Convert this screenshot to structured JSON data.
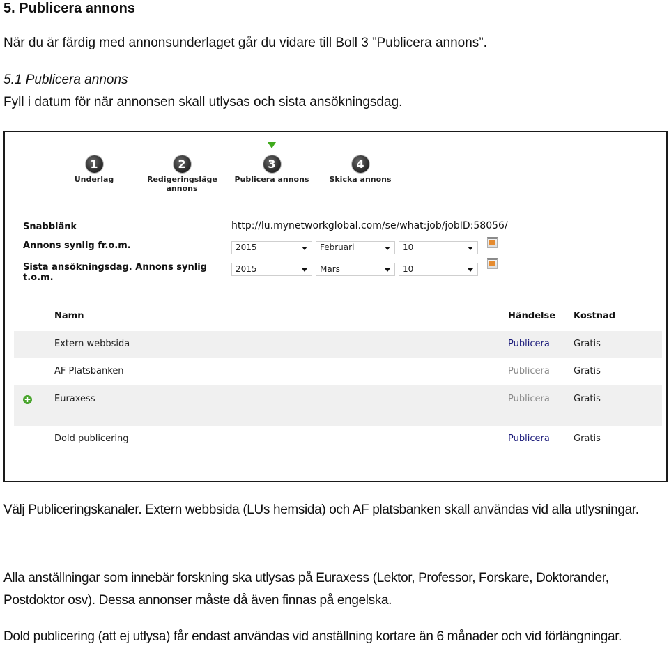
{
  "document": {
    "heading": "5.  Publicera annons",
    "intro": "När du är färdig med annonsunderlaget går du vidare till Boll 3 ”Publicera annons”.",
    "subheading": "5.1 Publicera annons",
    "subintro": "Fyll i datum för när annonsen skall utlysas och sista ansökningsdag.",
    "paragraphs": [
      "Välj Publiceringskanaler. Extern webbsida (LUs hemsida) och AF platsbanken skall användas vid alla utlysningar.",
      "Alla anställningar som innebär forskning ska utlysas på Euraxess (Lektor, Professor, Forskare, Doktorander, Postdoktor osv). Dessa annonser måste då även finnas på engelska.",
      "Dold publicering (att ej utlysa) får endast användas vid anställning kortare än 6 månader och vid förlängningar."
    ]
  },
  "screenshot": {
    "stepper": {
      "active_step": 3,
      "active_color": "#3faa1c",
      "steps": [
        {
          "number": "1",
          "label": "Underlag"
        },
        {
          "number": "2",
          "label": "Redigeringsläge annons"
        },
        {
          "number": "3",
          "label": "Publicera annons"
        },
        {
          "number": "4",
          "label": "Skicka annons"
        }
      ]
    },
    "form": {
      "quicklink_label": "Snabblänk",
      "quicklink_url": "http://lu.mynetworkglobal.com/se/what:job/jobID:58056/",
      "visible_from_label": "Annons synlig fr.o.m.",
      "visible_from": {
        "year": "2015",
        "month": "Februari",
        "day": "10",
        "icon": "calendar-icon"
      },
      "deadline_label": "Sista ansökningsdag. Annons synlig t.o.m.",
      "deadline": {
        "year": "2015",
        "month": "Mars",
        "day": "10",
        "icon": "calendar-icon"
      }
    },
    "channels_table": {
      "headers": {
        "name": "Namn",
        "event": "Händelse",
        "cost": "Kostnad"
      },
      "rows": [
        {
          "name": "Extern webbsida",
          "event": "Publicera",
          "event_enabled": true,
          "cost": "Gratis",
          "icon": ""
        },
        {
          "name": "AF Platsbanken",
          "event": "Publicera",
          "event_enabled": false,
          "cost": "Gratis",
          "icon": ""
        },
        {
          "name": "Euraxess",
          "event": "Publicera",
          "event_enabled": false,
          "cost": "Gratis",
          "icon": "plus-circle-icon"
        },
        {
          "name": "Dold publicering",
          "event": "Publicera",
          "event_enabled": true,
          "cost": "Gratis",
          "icon": ""
        }
      ],
      "link_color": "#1a1a7a",
      "disabled_color": "#8a8a8a"
    }
  }
}
